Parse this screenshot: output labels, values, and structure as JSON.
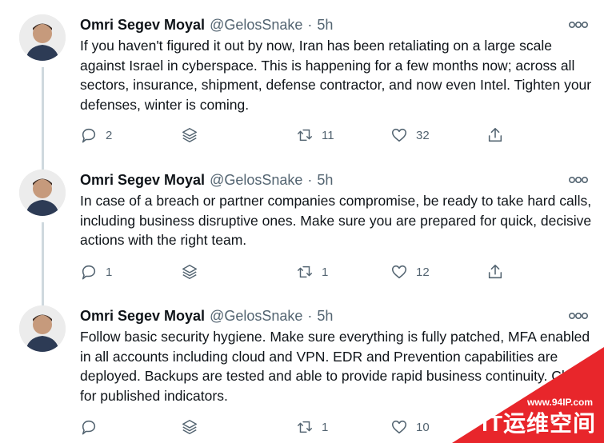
{
  "tweets": [
    {
      "name": "Omri Segev Moyal",
      "handle": "@GelosSnake",
      "separator": "·",
      "time": "5h",
      "text": "If you haven't figured it out by now, Iran has been retaliating on a large scale against Israel in cyberspace.  This is happening for a few months now; across all sectors, insurance, shipment, defense contractor, and now even Intel. Tighten your defenses, winter is coming.",
      "replies": "2",
      "retweets": "11",
      "likes": "32"
    },
    {
      "name": "Omri Segev Moyal",
      "handle": "@GelosSnake",
      "separator": "·",
      "time": "5h",
      "text": "In case of a breach or partner companies compromise, be ready to take hard calls, including business disruptive ones. Make sure you are prepared for quick, decisive actions with the right team.",
      "replies": "1",
      "retweets": "1",
      "likes": "12"
    },
    {
      "name": "Omri Segev Moyal",
      "handle": "@GelosSnake",
      "separator": "·",
      "time": "5h",
      "text": "Follow basic security hygiene. Make sure everything is fully patched, MFA enabled in all accounts including cloud and VPN. EDR and Prevention capabilities are deployed. Backups are tested and able to provide rapid business continuity. Check for published indicators.",
      "replies": "",
      "retweets": "1",
      "likes": "10"
    }
  ],
  "watermark": {
    "url": "www.94IP.com",
    "title": "IT运维空间",
    "color": "#e8262b"
  },
  "icons": [
    "reply-icon",
    "thread-stack-icon",
    "retweet-icon",
    "like-icon",
    "share-icon",
    "more-icon"
  ]
}
